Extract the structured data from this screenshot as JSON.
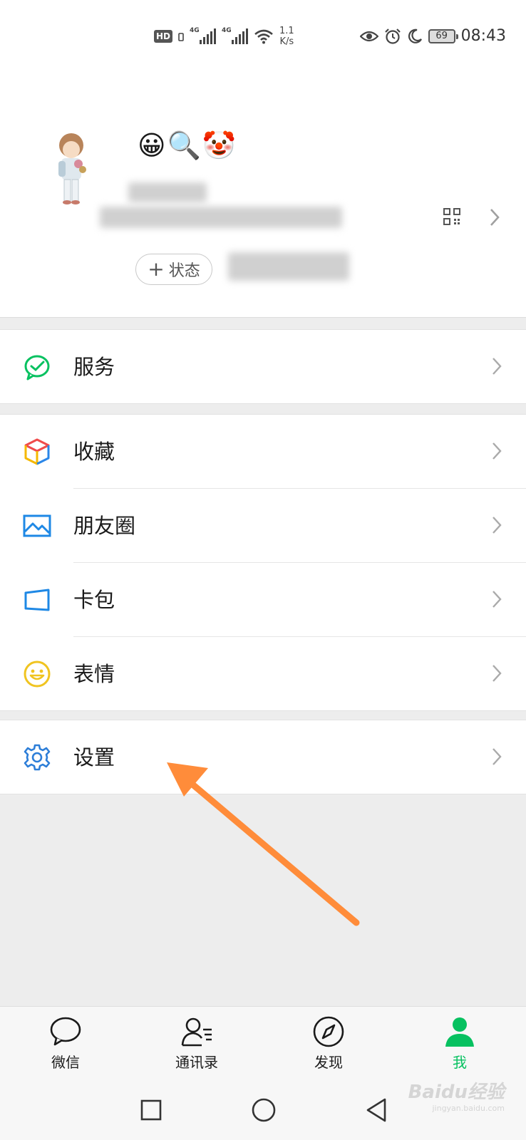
{
  "status_bar": {
    "hd_label": "HD",
    "sim1_label": "4G",
    "sim2_label": "4G",
    "speed_value": "1.1",
    "speed_unit": "K/s",
    "battery": "69",
    "time": "08:43",
    "icons": [
      "eye-icon",
      "alarm-icon",
      "moon-icon"
    ]
  },
  "profile": {
    "emojis": "😀🔍🤡",
    "status_button_label": "状态",
    "status_button_icon": "plus-icon"
  },
  "menu": {
    "services": {
      "label": "服务",
      "icon": "services-icon",
      "color": "#07c160"
    },
    "favorites": {
      "label": "收藏",
      "icon": "favorites-cube-icon"
    },
    "moments": {
      "label": "朋友圈",
      "icon": "moments-image-icon",
      "color": "#1e88e5"
    },
    "cards": {
      "label": "卡包",
      "icon": "card-icon",
      "color": "#1e88e5"
    },
    "stickers": {
      "label": "表情",
      "icon": "sticker-smile-icon",
      "color": "#f0c420"
    },
    "settings": {
      "label": "设置",
      "icon": "gear-icon",
      "color": "#2d7ed8"
    }
  },
  "tabbar": {
    "tabs": [
      {
        "label": "微信",
        "icon": "chat-bubble-icon"
      },
      {
        "label": "通讯录",
        "icon": "contacts-icon"
      },
      {
        "label": "发现",
        "icon": "compass-icon"
      },
      {
        "label": "我",
        "icon": "person-icon",
        "active": true
      }
    ],
    "active_color": "#07c160"
  },
  "watermark": {
    "brand": "Baidu经验",
    "url": "jingyan.baidu.com"
  },
  "annotation": {
    "arrow_color": "#ff8c3a",
    "points_to": "settings"
  }
}
